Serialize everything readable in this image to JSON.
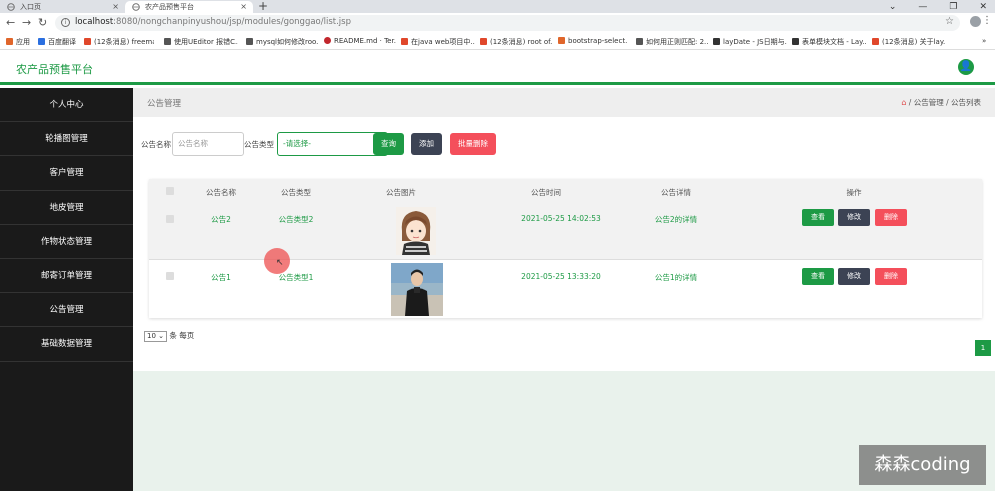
{
  "browser": {
    "tabs": [
      {
        "label": "入口页",
        "active": false
      },
      {
        "label": "农产品预售平台",
        "active": true
      }
    ],
    "new_tab": "+",
    "url_host": "localhost",
    "url_path": ":8080/nongchanpinyushou/jsp/modules/gonggao/list.jsp",
    "bookmarks": [
      {
        "label": "应用",
        "color": "#e0662b"
      },
      {
        "label": "百度翻译",
        "color": "#2b6fe0"
      },
      {
        "label": "(12条消息) freema...",
        "color": "#e0472b"
      },
      {
        "label": "使用UEditor 报错C...",
        "color": "#555555"
      },
      {
        "label": "mysql如何修改roo...",
        "color": "#555555"
      },
      {
        "label": "README.md · Ter...",
        "color": "#c2272d"
      },
      {
        "label": "在java web项目中...",
        "color": "#e0472b"
      },
      {
        "label": "(12条消息) root of...",
        "color": "#e0472b"
      },
      {
        "label": "bootstrap-select...",
        "color": "#e0662b"
      },
      {
        "label": "如何用正则匹配: 2...",
        "color": "#555555"
      },
      {
        "label": "layDate - JS日期与...",
        "color": "#333333"
      },
      {
        "label": "表单模块文档 - Lay...",
        "color": "#333333"
      },
      {
        "label": "(12条消息) 关于lay...",
        "color": "#e0472b"
      }
    ]
  },
  "app": {
    "title": "农产品预售平台",
    "accent": "#1d9a45"
  },
  "sidebar": {
    "items": [
      {
        "label": "个人中心"
      },
      {
        "label": "轮播图管理"
      },
      {
        "label": "客户管理"
      },
      {
        "label": "地皮管理"
      },
      {
        "label": "作物状态管理"
      },
      {
        "label": "邮寄订单管理"
      },
      {
        "label": "公告管理"
      },
      {
        "label": "基础数据管理"
      }
    ]
  },
  "page": {
    "title": "公告管理",
    "breadcrumb": "/ 公告管理 / 公告列表"
  },
  "search": {
    "name_label": "公告名称",
    "name_placeholder": "公告名称",
    "type_label": "公告类型",
    "type_selected": "-请选择-",
    "query_btn": "查询",
    "add_btn": "添加",
    "batch_delete_btn": "批量删除"
  },
  "table": {
    "columns": [
      "公告名称",
      "公告类型",
      "公告图片",
      "公告时间",
      "公告详情",
      "操作"
    ],
    "rows": [
      {
        "name": "公告2",
        "type": "公告类型2",
        "time": "2021-05-25 14:02:53",
        "detail": "公告2的详情"
      },
      {
        "name": "公告1",
        "type": "公告类型1",
        "time": "2021-05-25 13:33:20",
        "detail": "公告1的详情"
      }
    ],
    "actions": {
      "view": "查看",
      "edit": "修改",
      "delete": "删除"
    }
  },
  "pager": {
    "page_size": "10",
    "suffix": "条 每页",
    "current_page": "1"
  },
  "watermark": "森森coding"
}
